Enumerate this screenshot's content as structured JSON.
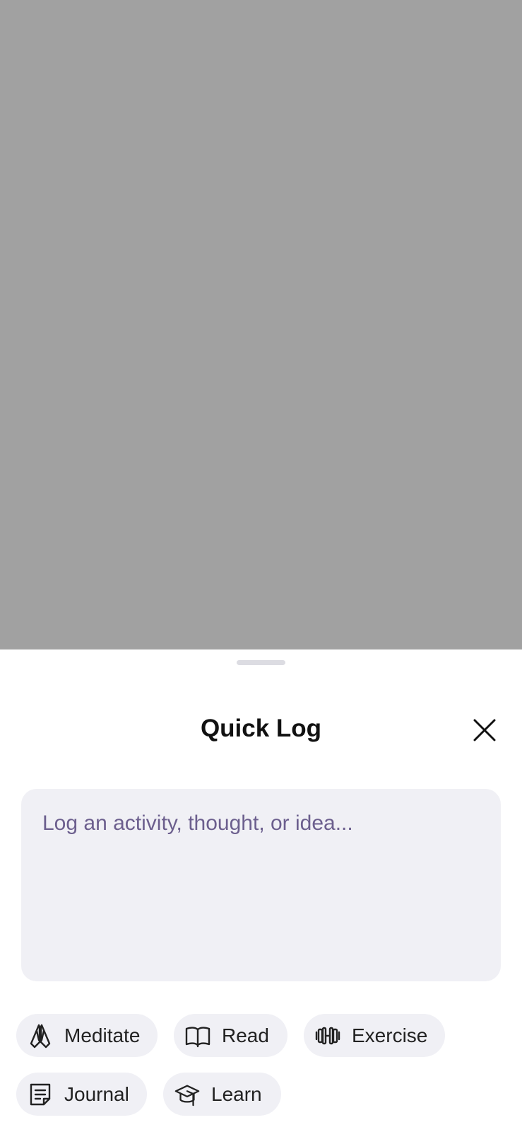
{
  "sheet": {
    "title": "Quick Log",
    "close_icon": "close-icon"
  },
  "input": {
    "placeholder": "Log an activity, thought, or idea...",
    "value": ""
  },
  "chips": [
    {
      "label": "Meditate",
      "icon": "praying-hands-icon"
    },
    {
      "label": "Read",
      "icon": "open-book-icon"
    },
    {
      "label": "Exercise",
      "icon": "dumbbell-icon"
    },
    {
      "label": "Journal",
      "icon": "note-icon"
    },
    {
      "label": "Learn",
      "icon": "graduation-cap-icon"
    }
  ],
  "colors": {
    "backdrop": "#a1a1a1",
    "sheet": "#ffffff",
    "chip_background": "#f0f0f5",
    "placeholder": "#6c5f8e"
  }
}
